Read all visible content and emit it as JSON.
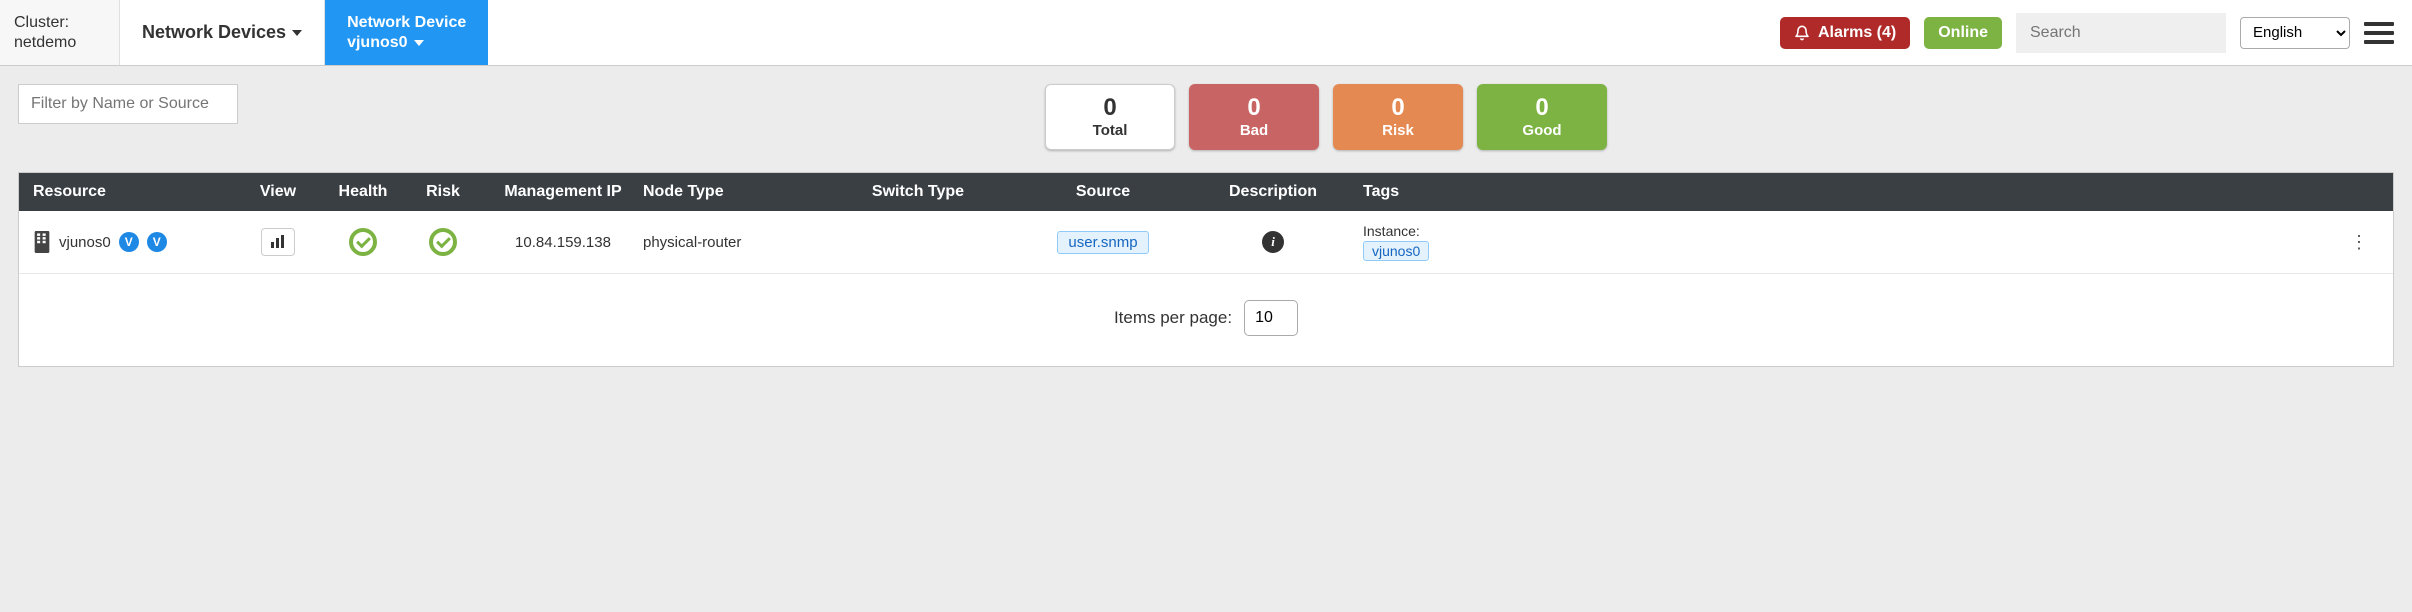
{
  "header": {
    "cluster_label": "Cluster:",
    "cluster_name": "netdemo",
    "crumb1": "Network Devices",
    "crumb2_top": "Network Device",
    "crumb2_bottom": "vjunos0",
    "alarms_label": "Alarms (4)",
    "online_label": "Online",
    "search_placeholder": "Search",
    "language": "English"
  },
  "filter_placeholder": "Filter by Name or Source",
  "stats": {
    "total": {
      "value": "0",
      "label": "Total"
    },
    "bad": {
      "value": "0",
      "label": "Bad"
    },
    "risk": {
      "value": "0",
      "label": "Risk"
    },
    "good": {
      "value": "0",
      "label": "Good"
    }
  },
  "columns": {
    "resource": "Resource",
    "view": "View",
    "health": "Health",
    "risk": "Risk",
    "ip": "Management IP",
    "node": "Node Type",
    "switch": "Switch Type",
    "source": "Source",
    "desc": "Description",
    "tags": "Tags"
  },
  "row": {
    "name": "vjunos0",
    "ip": "10.84.159.138",
    "node_type": "physical-router",
    "switch_type": "",
    "source": "user.snmp",
    "description": "",
    "tag_label": "Instance:",
    "tag_value": "vjunos0"
  },
  "pager": {
    "label": "Items per page:",
    "value": "10"
  }
}
